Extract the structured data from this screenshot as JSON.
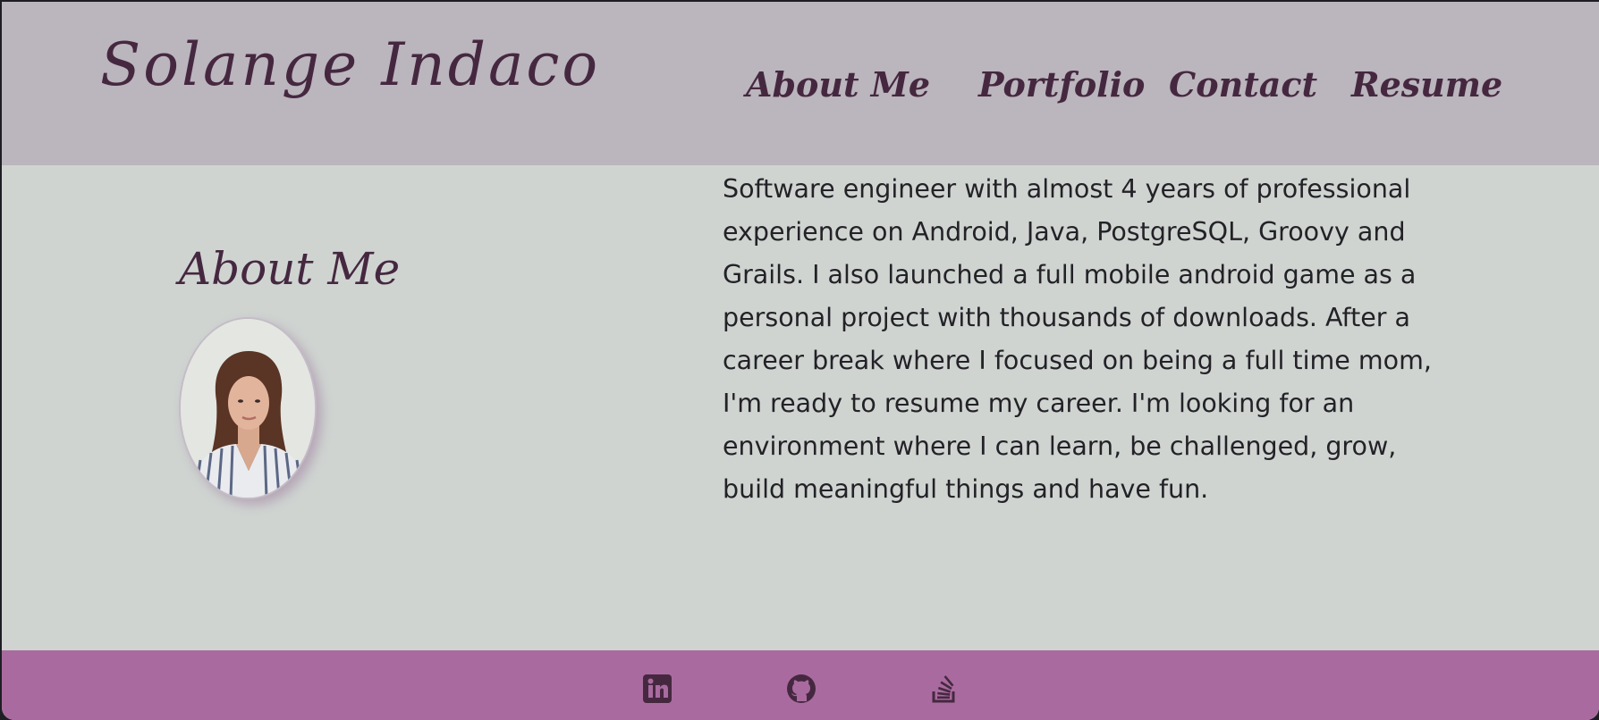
{
  "header": {
    "brand": "Solange Indaco",
    "nav": [
      "About Me",
      "Portfolio",
      "Contact",
      "Resume"
    ]
  },
  "about": {
    "heading": "About Me",
    "photo_icon": "profile-photo",
    "bio": "Software engineer with almost 4 years of professional experience on Android, Java, PostgreSQL, Groovy and Grails. I also launched a full mobile android game as a personal project with thousands of downloads. After a career break where I focused on being a full time mom, I'm ready to resume my career. I'm looking for an environment where I can learn, be challenged, grow, build meaningful things and have fun."
  },
  "footer": {
    "social_icons": [
      "linkedin-icon",
      "github-icon",
      "stackoverflow-icon"
    ]
  },
  "colors": {
    "header_bg": "#bbb5bd",
    "body_bg": "#cfd4d1",
    "footer_bg": "#a96b9f",
    "accent_text": "#452840",
    "body_text": "#232227"
  }
}
